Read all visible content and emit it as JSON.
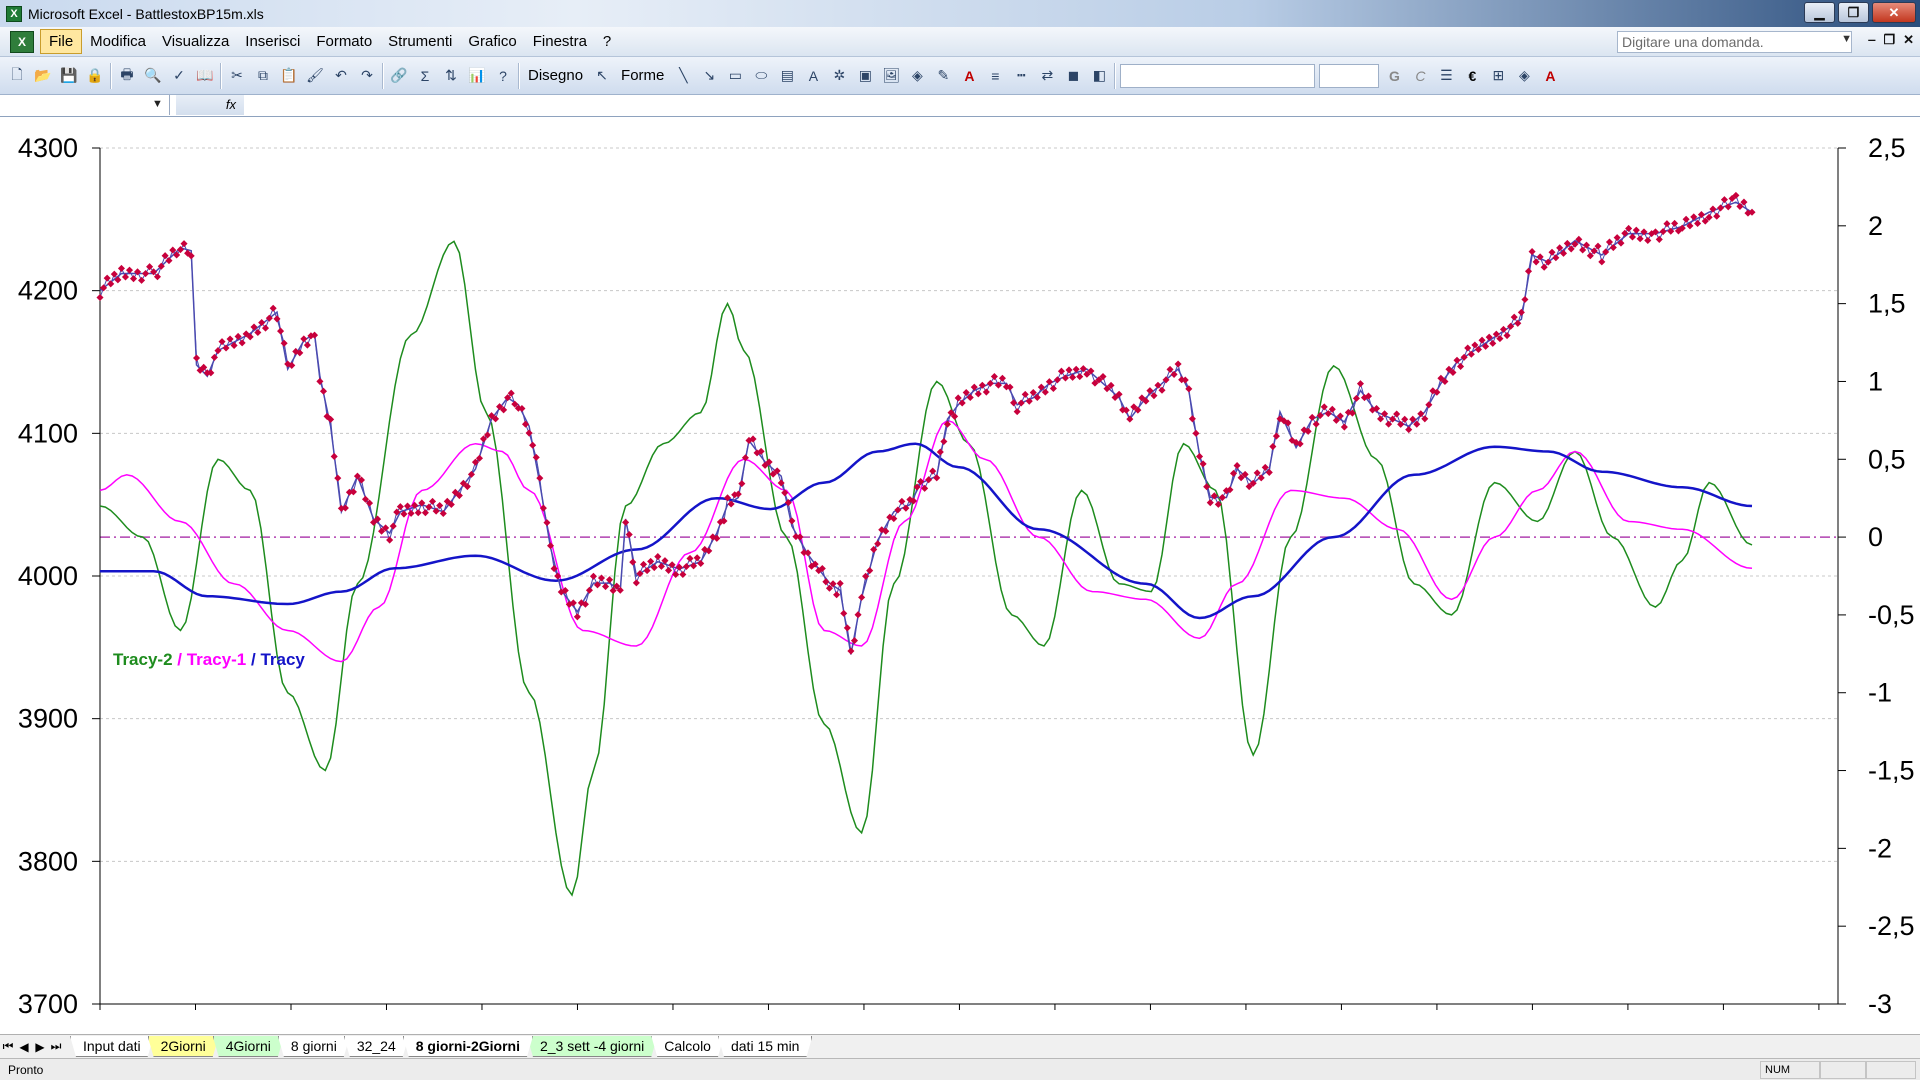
{
  "window": {
    "title": "Microsoft Excel - BattlestoxBP15m.xls",
    "app_icon": "X"
  },
  "menubar": {
    "items": [
      "File",
      "Modifica",
      "Visualizza",
      "Inserisci",
      "Formato",
      "Strumenti",
      "Grafico",
      "Finestra",
      "?"
    ],
    "active_index": 0,
    "ask_placeholder": "Digitare una domanda."
  },
  "toolbar": {
    "draw_label": "Disegno",
    "shapes_label": "Forme",
    "bold_label": "G",
    "italic_label": "C",
    "euro_label": "€"
  },
  "formulabar": {
    "name_box": "",
    "fx_label": "fx"
  },
  "colors": {
    "price": "#c8003c",
    "price_line": "#4a4ab0",
    "tracy": "#1414c8",
    "tracy_1": "#ff00ff",
    "tracy_2": "#1e8c1e",
    "zero_line": "#b040b0"
  },
  "chart_data": {
    "type": "line",
    "grid": true,
    "legend": {
      "placement": "left-middle",
      "entries": [
        "Tracy-2",
        "Tracy-1",
        "Tracy"
      ],
      "separator": " / "
    },
    "y_left": {
      "ylim": [
        3700,
        4300
      ],
      "ticks": [
        "4300",
        "4200",
        "4100",
        "4000",
        "3900",
        "3800",
        "3700"
      ]
    },
    "y_right": {
      "ylim": [
        -3,
        2.5
      ],
      "ticks": [
        "2,5",
        "2",
        "1,5",
        "1",
        "0,5",
        "0",
        "-0,5",
        "-1",
        "-1,5",
        "-2",
        "-2,5",
        "-3"
      ]
    },
    "x_count": 240,
    "series": [
      {
        "name": "",
        "axis": "left",
        "color_key": "price",
        "markers": true,
        "keypoints": [
          [
            0,
            4200
          ],
          [
            4,
            4212
          ],
          [
            10,
            4212
          ],
          [
            15,
            4230
          ],
          [
            17,
            4228
          ],
          [
            18,
            4148
          ],
          [
            20,
            4140
          ],
          [
            22,
            4158
          ],
          [
            28,
            4170
          ],
          [
            33,
            4185
          ],
          [
            35,
            4145
          ],
          [
            38,
            4165
          ],
          [
            40,
            4170
          ],
          [
            41,
            4140
          ],
          [
            43,
            4105
          ],
          [
            45,
            4045
          ],
          [
            48,
            4070
          ],
          [
            51,
            4040
          ],
          [
            54,
            4030
          ],
          [
            56,
            4045
          ],
          [
            60,
            4050
          ],
          [
            64,
            4045
          ],
          [
            67,
            4060
          ],
          [
            70,
            4075
          ],
          [
            73,
            4110
          ],
          [
            76,
            4125
          ],
          [
            78,
            4120
          ],
          [
            80,
            4105
          ],
          [
            82,
            4065
          ],
          [
            84,
            4020
          ],
          [
            86,
            3990
          ],
          [
            89,
            3975
          ],
          [
            92,
            3995
          ],
          [
            95,
            3995
          ],
          [
            97,
            3990
          ],
          [
            98,
            4040
          ],
          [
            100,
            4000
          ],
          [
            104,
            4010
          ],
          [
            108,
            4005
          ],
          [
            112,
            4010
          ],
          [
            115,
            4030
          ],
          [
            117,
            4050
          ],
          [
            119,
            4055
          ],
          [
            121,
            4095
          ],
          [
            124,
            4080
          ],
          [
            127,
            4070
          ],
          [
            129,
            4035
          ],
          [
            132,
            4015
          ],
          [
            134,
            4005
          ],
          [
            136,
            3995
          ],
          [
            138,
            3990
          ],
          [
            140,
            3945
          ],
          [
            142,
            3985
          ],
          [
            145,
            4025
          ],
          [
            148,
            4045
          ],
          [
            151,
            4050
          ],
          [
            153,
            4065
          ],
          [
            156,
            4070
          ],
          [
            158,
            4110
          ],
          [
            160,
            4120
          ],
          [
            163,
            4130
          ],
          [
            166,
            4135
          ],
          [
            169,
            4135
          ],
          [
            171,
            4120
          ],
          [
            174,
            4125
          ],
          [
            177,
            4135
          ],
          [
            180,
            4140
          ],
          [
            184,
            4145
          ],
          [
            187,
            4135
          ],
          [
            190,
            4125
          ],
          [
            192,
            4110
          ],
          [
            195,
            4125
          ],
          [
            198,
            4135
          ],
          [
            201,
            4145
          ],
          [
            203,
            4130
          ],
          [
            205,
            4085
          ],
          [
            207,
            4055
          ],
          [
            210,
            4055
          ],
          [
            212,
            4075
          ],
          [
            215,
            4065
          ],
          [
            218,
            4075
          ],
          [
            220,
            4115
          ],
          [
            223,
            4090
          ],
          [
            226,
            4110
          ],
          [
            229,
            4115
          ],
          [
            232,
            4108
          ],
          [
            235,
            4130
          ],
          [
            238,
            4115
          ],
          [
            241,
            4110
          ],
          [
            244,
            4105
          ],
          [
            247,
            4115
          ],
          [
            250,
            4135
          ],
          [
            253,
            4150
          ],
          [
            257,
            4160
          ],
          [
            261,
            4170
          ],
          [
            265,
            4180
          ],
          [
            267,
            4225
          ],
          [
            270,
            4220
          ],
          [
            275,
            4235
          ],
          [
            280,
            4225
          ],
          [
            285,
            4240
          ],
          [
            290,
            4240
          ],
          [
            295,
            4245
          ],
          [
            300,
            4255
          ],
          [
            305,
            4262
          ],
          [
            308,
            4255
          ]
        ]
      },
      {
        "name": "Tracy",
        "axis": "right",
        "color_key": "tracy",
        "markers": false,
        "keypoints": [
          [
            0,
            -0.22
          ],
          [
            10,
            -0.22
          ],
          [
            20,
            -0.38
          ],
          [
            35,
            -0.43
          ],
          [
            45,
            -0.35
          ],
          [
            55,
            -0.2
          ],
          [
            70,
            -0.12
          ],
          [
            85,
            -0.28
          ],
          [
            100,
            -0.08
          ],
          [
            115,
            0.25
          ],
          [
            125,
            0.18
          ],
          [
            135,
            0.35
          ],
          [
            145,
            0.55
          ],
          [
            152,
            0.6
          ],
          [
            160,
            0.45
          ],
          [
            175,
            0.05
          ],
          [
            195,
            -0.3
          ],
          [
            205,
            -0.52
          ],
          [
            215,
            -0.38
          ],
          [
            230,
            0.0
          ],
          [
            245,
            0.4
          ],
          [
            260,
            0.58
          ],
          [
            270,
            0.55
          ],
          [
            280,
            0.42
          ],
          [
            295,
            0.32
          ],
          [
            308,
            0.2
          ]
        ]
      },
      {
        "name": "Tracy-1",
        "axis": "right",
        "color_key": "tracy_1",
        "markers": false,
        "keypoints": [
          [
            0,
            0.3
          ],
          [
            5,
            0.4
          ],
          [
            15,
            0.1
          ],
          [
            25,
            -0.3
          ],
          [
            35,
            -0.6
          ],
          [
            45,
            -0.8
          ],
          [
            52,
            -0.45
          ],
          [
            60,
            0.3
          ],
          [
            70,
            0.6
          ],
          [
            75,
            0.55
          ],
          [
            80,
            0.3
          ],
          [
            90,
            -0.6
          ],
          [
            100,
            -0.7
          ],
          [
            110,
            -0.1
          ],
          [
            120,
            0.5
          ],
          [
            128,
            0.3
          ],
          [
            135,
            -0.6
          ],
          [
            142,
            -0.7
          ],
          [
            150,
            0.1
          ],
          [
            158,
            0.75
          ],
          [
            165,
            0.5
          ],
          [
            175,
            0.0
          ],
          [
            185,
            -0.35
          ],
          [
            195,
            -0.4
          ],
          [
            205,
            -0.65
          ],
          [
            212,
            -0.3
          ],
          [
            222,
            0.3
          ],
          [
            232,
            0.25
          ],
          [
            242,
            0.05
          ],
          [
            252,
            -0.4
          ],
          [
            260,
            0.0
          ],
          [
            268,
            0.3
          ],
          [
            275,
            0.55
          ],
          [
            285,
            0.1
          ],
          [
            295,
            0.05
          ],
          [
            308,
            -0.2
          ]
        ]
      },
      {
        "name": "Tracy-2",
        "axis": "right",
        "color_key": "tracy_2",
        "markers": false,
        "keypoints": [
          [
            0,
            0.2
          ],
          [
            8,
            0.0
          ],
          [
            15,
            -0.6
          ],
          [
            22,
            0.5
          ],
          [
            28,
            0.3
          ],
          [
            35,
            -1.0
          ],
          [
            42,
            -1.5
          ],
          [
            48,
            -0.3
          ],
          [
            58,
            1.3
          ],
          [
            66,
            1.9
          ],
          [
            72,
            0.8
          ],
          [
            80,
            -1.0
          ],
          [
            88,
            -2.3
          ],
          [
            92,
            -1.5
          ],
          [
            98,
            0.2
          ],
          [
            105,
            0.6
          ],
          [
            112,
            0.8
          ],
          [
            117,
            1.5
          ],
          [
            120,
            1.2
          ],
          [
            128,
            0.0
          ],
          [
            135,
            -1.2
          ],
          [
            142,
            -1.9
          ],
          [
            148,
            -0.3
          ],
          [
            156,
            1.0
          ],
          [
            162,
            0.6
          ],
          [
            170,
            -0.5
          ],
          [
            176,
            -0.7
          ],
          [
            183,
            0.3
          ],
          [
            190,
            -0.3
          ],
          [
            196,
            -0.35
          ],
          [
            202,
            0.6
          ],
          [
            208,
            0.3
          ],
          [
            215,
            -1.4
          ],
          [
            222,
            0.0
          ],
          [
            230,
            1.1
          ],
          [
            238,
            0.5
          ],
          [
            245,
            -0.3
          ],
          [
            252,
            -0.5
          ],
          [
            260,
            0.35
          ],
          [
            268,
            0.1
          ],
          [
            275,
            0.55
          ],
          [
            282,
            0.0
          ],
          [
            290,
            -0.45
          ],
          [
            295,
            -0.15
          ],
          [
            300,
            0.35
          ],
          [
            308,
            -0.05
          ]
        ]
      }
    ],
    "zero_line": {
      "axis": "right",
      "value": 0
    }
  },
  "sheet_tabs": [
    {
      "label": "Input dati",
      "style": "plain"
    },
    {
      "label": "2Giorni",
      "style": "yellow"
    },
    {
      "label": "4Giorni",
      "style": "green"
    },
    {
      "label": "8 giorni",
      "style": "plain"
    },
    {
      "label": "32_24",
      "style": "plain"
    },
    {
      "label": "8 giorni-2Giorni",
      "style": "active"
    },
    {
      "label": "2_3 sett -4 giorni",
      "style": "green"
    },
    {
      "label": "Calcolo",
      "style": "plain"
    },
    {
      "label": "dati 15 min",
      "style": "plain"
    }
  ],
  "statusbar": {
    "text": "Pronto",
    "num": "NUM"
  }
}
